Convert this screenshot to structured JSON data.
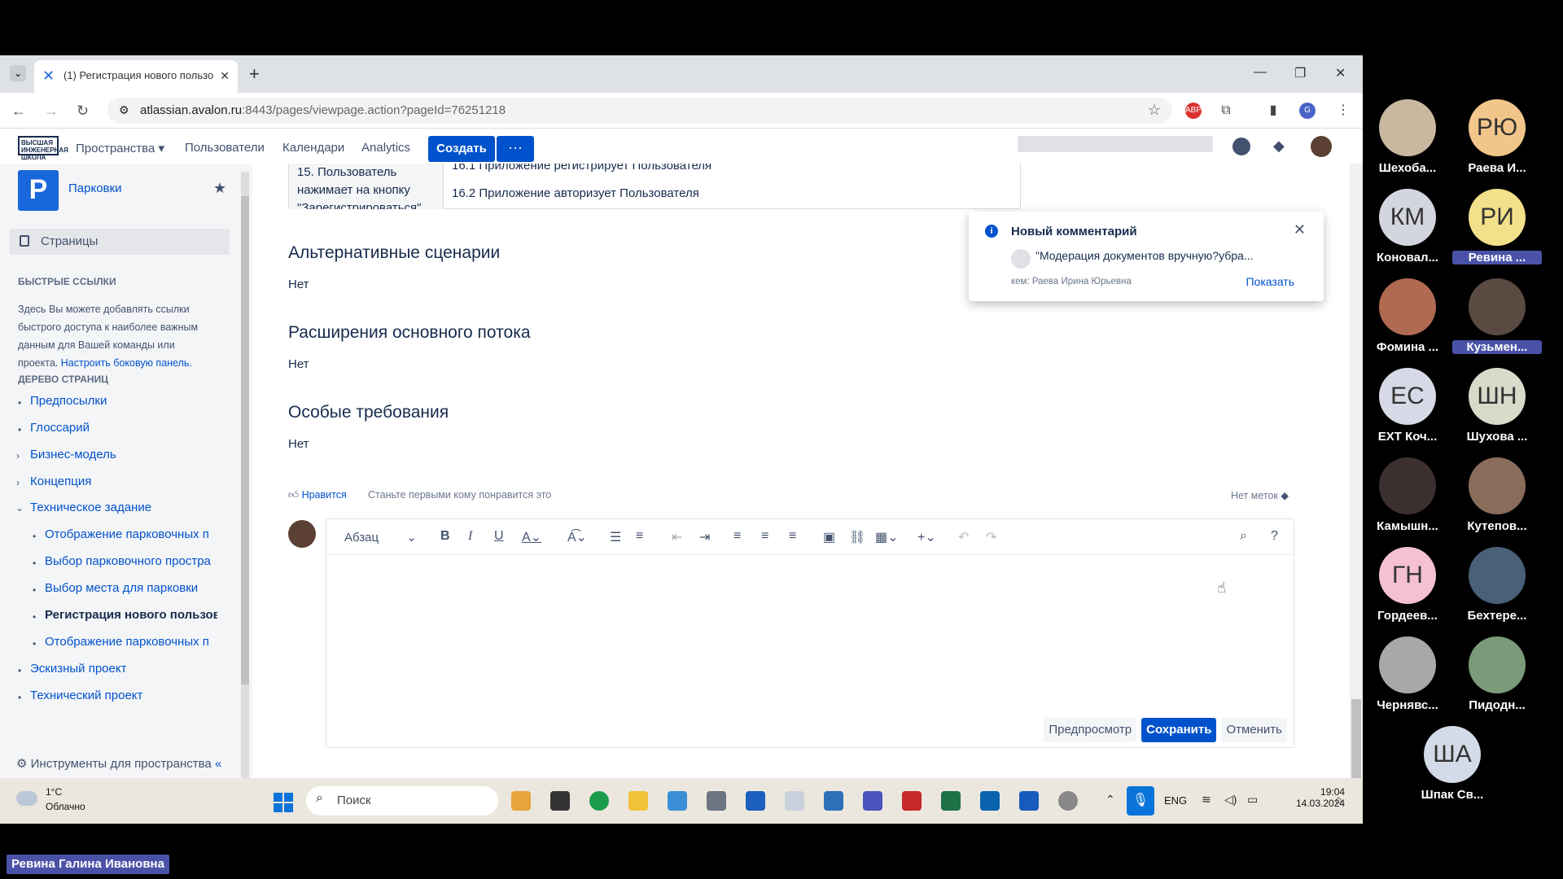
{
  "browser": {
    "tab_title": "(1) Регистрация нового пользо",
    "url_host": "atlassian.avalon.ru",
    "url_rest": ":8443/pages/viewpage.action?pageId=76251218"
  },
  "topnav": {
    "logo_text": "ВЫСШАЯ ИНЖЕНЕРНАЯ ШКОЛА",
    "spaces": "Пространства",
    "users": "Пользователи",
    "calendars": "Календари",
    "analytics": "Analytics",
    "create": "Создать",
    "more": "···"
  },
  "sidebar": {
    "space_name": "Парковки",
    "space_logo": "P",
    "pages": "Страницы",
    "quick_links_title": "БЫСТРЫЕ ССЫЛКИ",
    "quick_links_text": "Здесь Вы можете добавлять ссылки быстрого доступа к наиболее важным данным для Вашей команды или проекта.",
    "quick_links_link": "Настроить боковую панель.",
    "tree_title": "ДЕРЕВО СТРАНИЦ",
    "tree": [
      "Предпосылки",
      "Глоссарий",
      "Бизнес-модель",
      "Концепция",
      "Техническое задание",
      "Отображение парковочных п",
      "Выбор парковочного простра",
      "Выбор места для парковки",
      "Регистрация нового пользов",
      "Отображение парковочных п",
      "Эскизный проект",
      "Технический проект"
    ],
    "tools": "Инструменты для пространства"
  },
  "content": {
    "table_cell_left": "15. Пользователь нажимает на кнопку \"Зарегистрироваться\"",
    "table_row1": "16.1 Приложение регистрирует Пользователя",
    "table_row2": "16.2 Приложение авторизует Пользователя",
    "sections": [
      {
        "heading": "Альтернативные сценарии",
        "value": "Нет"
      },
      {
        "heading": "Расширения основного потока",
        "value": "Нет"
      },
      {
        "heading": "Особые требования",
        "value": "Нет"
      }
    ],
    "like": "Нравится",
    "like_hint": "Станьте первыми кому понравится это",
    "no_labels": "Нет меток"
  },
  "editor": {
    "paragraph_style": "Абзац",
    "preview": "Предпросмотр",
    "save": "Сохранить",
    "cancel": "Отменить"
  },
  "notification": {
    "title": "Новый комментарий",
    "text": "\"Модерация документов вручную?убра...",
    "by": "кем: Раева Ирина Юрьевна",
    "show": "Показать"
  },
  "taskbar": {
    "temp": "1°C",
    "weather": "Облачно",
    "search": "Поиск",
    "lang": "ENG",
    "time": "19:04",
    "date": "14.03.2024"
  },
  "participants": [
    {
      "initials": "",
      "name": "Шехоба...",
      "color": "#c9b8a0"
    },
    {
      "initials": "РЮ",
      "name": "Раева И...",
      "color": "#f2c68a"
    },
    {
      "initials": "КМ",
      "name": "Коновал...",
      "color": "#d4d6df"
    },
    {
      "initials": "РИ",
      "name": "Ревина ...",
      "color": "#f3e08a",
      "highlight": true
    },
    {
      "initials": "",
      "name": "Фомина ...",
      "color": "#b06a52"
    },
    {
      "initials": "",
      "name": "Кузьмен...",
      "color": "#5a4a42",
      "highlight": true
    },
    {
      "initials": "ЕС",
      "name": "EXT Коч...",
      "color": "#d7d9e6"
    },
    {
      "initials": "ШН",
      "name": "Шухова ...",
      "color": "#d7dbc9"
    },
    {
      "initials": "",
      "name": "Камышн...",
      "color": "#3b2f2f"
    },
    {
      "initials": "",
      "name": "Кутепов...",
      "color": "#8a6c5a"
    },
    {
      "initials": "ГН",
      "name": "Гордеев...",
      "color": "#f4c1d0"
    },
    {
      "initials": "",
      "name": "Бехтере...",
      "color": "#4a6078"
    },
    {
      "initials": "",
      "name": "Чернявс...",
      "color": "#a8a8a8"
    },
    {
      "initials": "",
      "name": "Пидодн...",
      "color": "#7a9a7a"
    },
    {
      "initials": "ША",
      "name": "Шпак Св...",
      "color": "#d3dbe8"
    }
  ],
  "presenter": "Ревина Галина Ивановна"
}
